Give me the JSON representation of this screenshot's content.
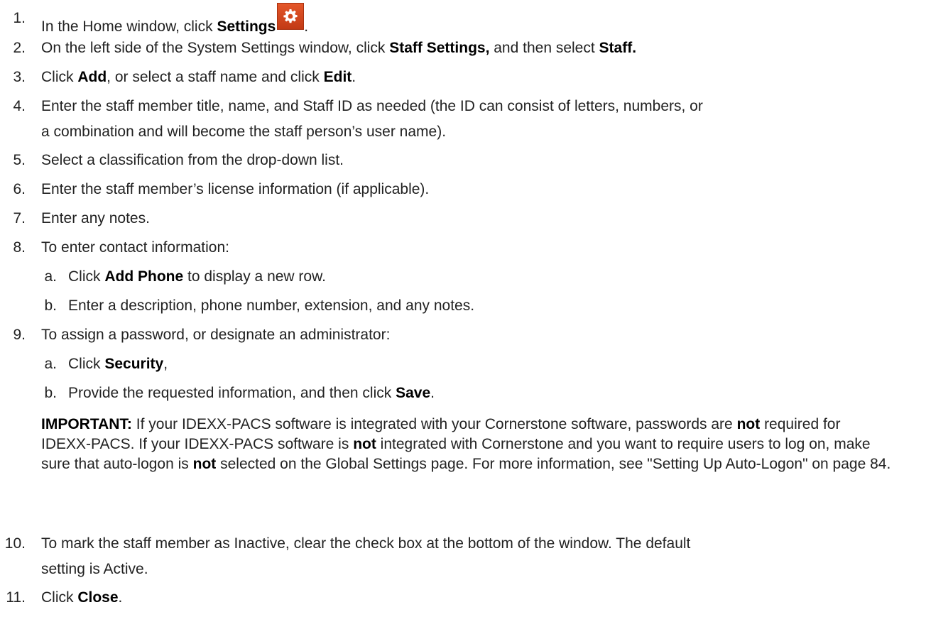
{
  "steps": [
    {
      "num": "1.",
      "pre": "In the Home window, click ",
      "b1": "Settings",
      "post": "."
    },
    {
      "num": "2.",
      "pre": "On the left side of the System Settings window, click ",
      "b1": "Staff Settings,",
      "mid": " and then select ",
      "b2": "Staff."
    },
    {
      "num": "3.",
      "pre": "Click ",
      "b1": "Add",
      "mid": ", or select a staff name and click ",
      "b2": "Edit",
      "post": "."
    },
    {
      "num": "4.",
      "line1": "Enter the staff member title, name, and Staff ID as needed (the ID can consist of letters, numbers, or",
      "line2": "a combination and will become the staff person’s user name)."
    },
    {
      "num": "5.",
      "text": "Select a classification from the drop-down list."
    },
    {
      "num": "6.",
      "text": "Enter the staff member’s license information (if applicable)."
    },
    {
      "num": "7.",
      "text": "Enter any notes."
    },
    {
      "num": "8.",
      "text": "To enter contact information:"
    },
    {
      "num": "9.",
      "text": "To assign a password, or designate an administrator:"
    },
    {
      "num": "10.",
      "line1": "To mark the staff member as Inactive, clear the check box at the bottom of the window. The default",
      "line2": "setting is Active."
    },
    {
      "num": "11.",
      "pre": "Click ",
      "b1": "Close",
      "post": "."
    }
  ],
  "step8_sub": [
    {
      "num": "a.",
      "pre": "Click ",
      "b1": "Add Phone",
      "post": " to display a new row."
    },
    {
      "num": "b.",
      "text": "Enter a description, phone number, extension, and any notes."
    }
  ],
  "step9_sub": [
    {
      "num": "a.",
      "pre": "Click ",
      "b1": "Security",
      "post": ","
    },
    {
      "num": "b.",
      "pre": "Provide the requested information, and then click ",
      "b1": "Save",
      "post": "."
    }
  ],
  "important": {
    "label": "IMPORTANT:",
    "t1": " If your IDEXX-PACS software is integrated with your Cornerstone software, passwords are ",
    "not1": "not",
    "t2": " required for IDEXX-PACS. If your IDEXX-PACS software is ",
    "not2": "not",
    "t3": " integrated with Cornerstone and you want to require users to log on, make sure that auto-logon is ",
    "not3": "not",
    "t4": " selected on the Global Settings page. For more information, see \"Setting Up Auto-Logon\" on page 84."
  },
  "icons": {
    "settings": "gear-icon"
  },
  "colors": {
    "settings_icon_bg": "#d9471f"
  }
}
